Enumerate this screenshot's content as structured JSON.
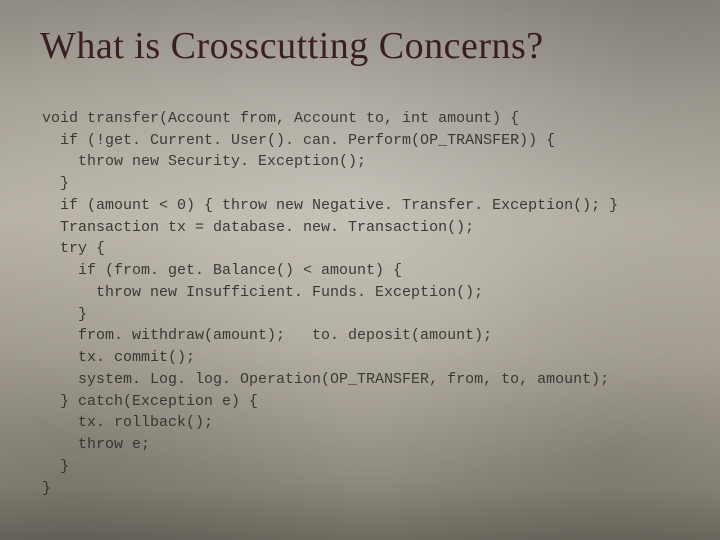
{
  "title": "What is Crosscutting Concerns?",
  "code": {
    "l01": "void transfer(Account from, Account to, int amount) {",
    "l02": "  if (!get. Current. User(). can. Perform(OP_TRANSFER)) {",
    "l03": "    throw new Security. Exception();",
    "l04": "  }",
    "l05": "  if (amount < 0) { throw new Negative. Transfer. Exception(); }",
    "l06": "  Transaction tx = database. new. Transaction();",
    "l07": "  try {",
    "l08": "    if (from. get. Balance() < amount) {",
    "l09": "      throw new Insufficient. Funds. Exception();",
    "l10": "    }",
    "l11": "    from. withdraw(amount);   to. deposit(amount);",
    "l12": "    tx. commit();",
    "l13": "    system. Log. log. Operation(OP_TRANSFER, from, to, amount);",
    "l14": "  } catch(Exception e) {",
    "l15": "    tx. rollback();",
    "l16": "    throw e;",
    "l17": "  }",
    "l18": "}"
  }
}
